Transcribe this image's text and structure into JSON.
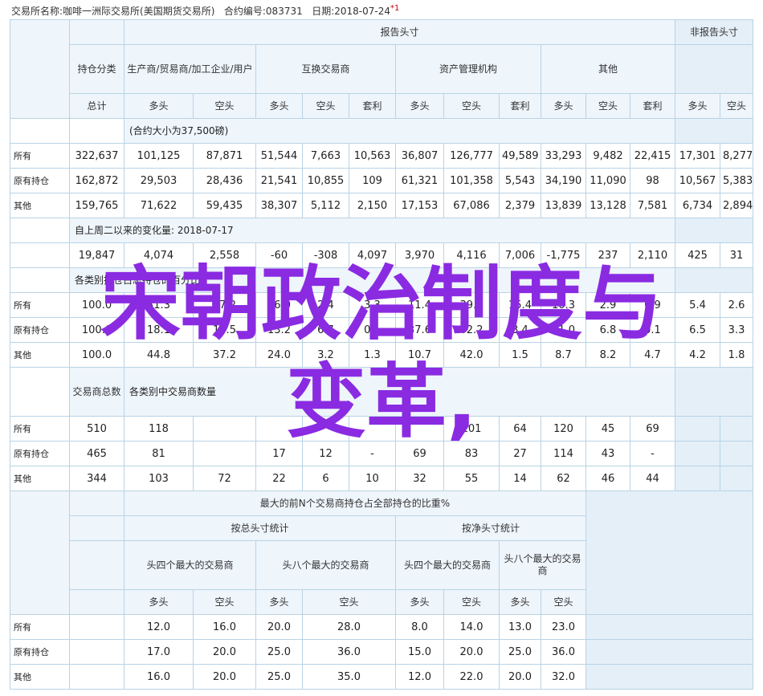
{
  "header": {
    "exchange_label": "交易所名称:咖啡一洲际交易所(美国期货交易所)",
    "contract_label": "合约编号:083731",
    "date_label": "日期:2018-07-24",
    "marker": "*1"
  },
  "headers": {
    "report_group": "报告头寸",
    "nonreport_group": "非报告头寸",
    "holding_class": "持仓分类",
    "producer": "生产商/贸易商/加工企业/用户",
    "swap": "互换交易商",
    "managed_money": "资产管理机构",
    "other": "其他",
    "total": "总计",
    "long": "多头",
    "short": "空头",
    "spread": "套利"
  },
  "section1": {
    "title": "(合约大小为37,500磅)",
    "rows": [
      {
        "label": "所有",
        "cells": [
          "322,637",
          "101,125",
          "87,871",
          "51,544",
          "7,663",
          "10,563",
          "36,807",
          "126,777",
          "49,589",
          "33,293",
          "9,482",
          "22,415",
          "17,301",
          "8,277"
        ]
      },
      {
        "label": "原有持仓",
        "cells": [
          "162,872",
          "29,503",
          "28,436",
          "21,541",
          "10,855",
          "109",
          "61,321",
          "101,358",
          "5,543",
          "34,190",
          "11,090",
          "98",
          "10,567",
          "5,383"
        ]
      },
      {
        "label": "其他",
        "cells": [
          "159,765",
          "71,622",
          "59,435",
          "38,307",
          "5,112",
          "2,150",
          "17,153",
          "67,086",
          "2,379",
          "13,839",
          "13,128",
          "7,581",
          "6,734",
          "2,894"
        ]
      }
    ]
  },
  "section2": {
    "title": "自上周二以来的变化量: 2018-07-17",
    "row": [
      "19,847",
      "4,074",
      "2,558",
      "-60",
      "-308",
      "4,097",
      "3,970",
      "4,116",
      "7,006",
      "-1,775",
      "237",
      "2,110",
      "425",
      "31"
    ]
  },
  "section3": {
    "title_visible": "各类别持仓占总持仓的百分比",
    "rows": [
      {
        "label": "所有",
        "cells": [
          "100.0",
          "31.3",
          "27.2",
          "16.0",
          "2.4",
          "3.3",
          "11.4",
          "39.3",
          "15.4",
          "10.3",
          "2.9",
          "6.9",
          "5.4",
          "2.6"
        ]
      },
      {
        "label": "原有持仓",
        "cells": [
          "100.0",
          "18.1",
          "17.5",
          "13.2",
          "6.7",
          "0.1",
          "37.6",
          "62.2",
          "3.4",
          "21.0",
          "6.8",
          "0.1",
          "6.5",
          "3.3"
        ]
      },
      {
        "label": "其他",
        "cells": [
          "100.0",
          "44.8",
          "37.2",
          "24.0",
          "3.2",
          "1.3",
          "10.7",
          "42.0",
          "1.5",
          "8.7",
          "8.2",
          "4.7",
          "4.2",
          "1.8"
        ]
      }
    ]
  },
  "section4": {
    "trader_count_label": "交易商总数",
    "title": "各类别中交易商数量",
    "rows": [
      {
        "label": "所有",
        "cells": [
          "510",
          "118",
          "",
          "",
          "",
          "",
          "",
          "101",
          "64",
          "120",
          "45",
          "69",
          "",
          ""
        ]
      },
      {
        "label": "原有持仓",
        "cells": [
          "465",
          "81",
          "",
          "17",
          "12",
          "-",
          "69",
          "83",
          "27",
          "114",
          "43",
          "-",
          "",
          ""
        ]
      },
      {
        "label": "其他",
        "cells": [
          "344",
          "103",
          "72",
          "22",
          "6",
          "10",
          "32",
          "55",
          "14",
          "62",
          "46",
          "44",
          "",
          ""
        ]
      }
    ]
  },
  "concentration": {
    "title": "最大的前N个交易商持仓占全部持仓的比重%",
    "gross": "按总头寸统计",
    "net": "按净头寸统计",
    "top4": "头四个最大的交易商",
    "top8": "头八个最大的交易商",
    "long": "多头",
    "short": "空头",
    "rows": [
      {
        "label": "所有",
        "cells": [
          "12.0",
          "16.0",
          "20.0",
          "28.0",
          "8.0",
          "14.0",
          "13.0",
          "23.0"
        ]
      },
      {
        "label": "原有持仓",
        "cells": [
          "17.0",
          "20.0",
          "25.0",
          "36.0",
          "15.0",
          "20.0",
          "25.0",
          "36.0"
        ]
      },
      {
        "label": "其他",
        "cells": [
          "16.0",
          "20.0",
          "25.0",
          "35.0",
          "12.0",
          "22.0",
          "20.0",
          "32.0"
        ]
      }
    ]
  },
  "overlay": {
    "line1": "宋朝政治制度与",
    "line2": "变革,",
    "color": "#8a2be2"
  }
}
